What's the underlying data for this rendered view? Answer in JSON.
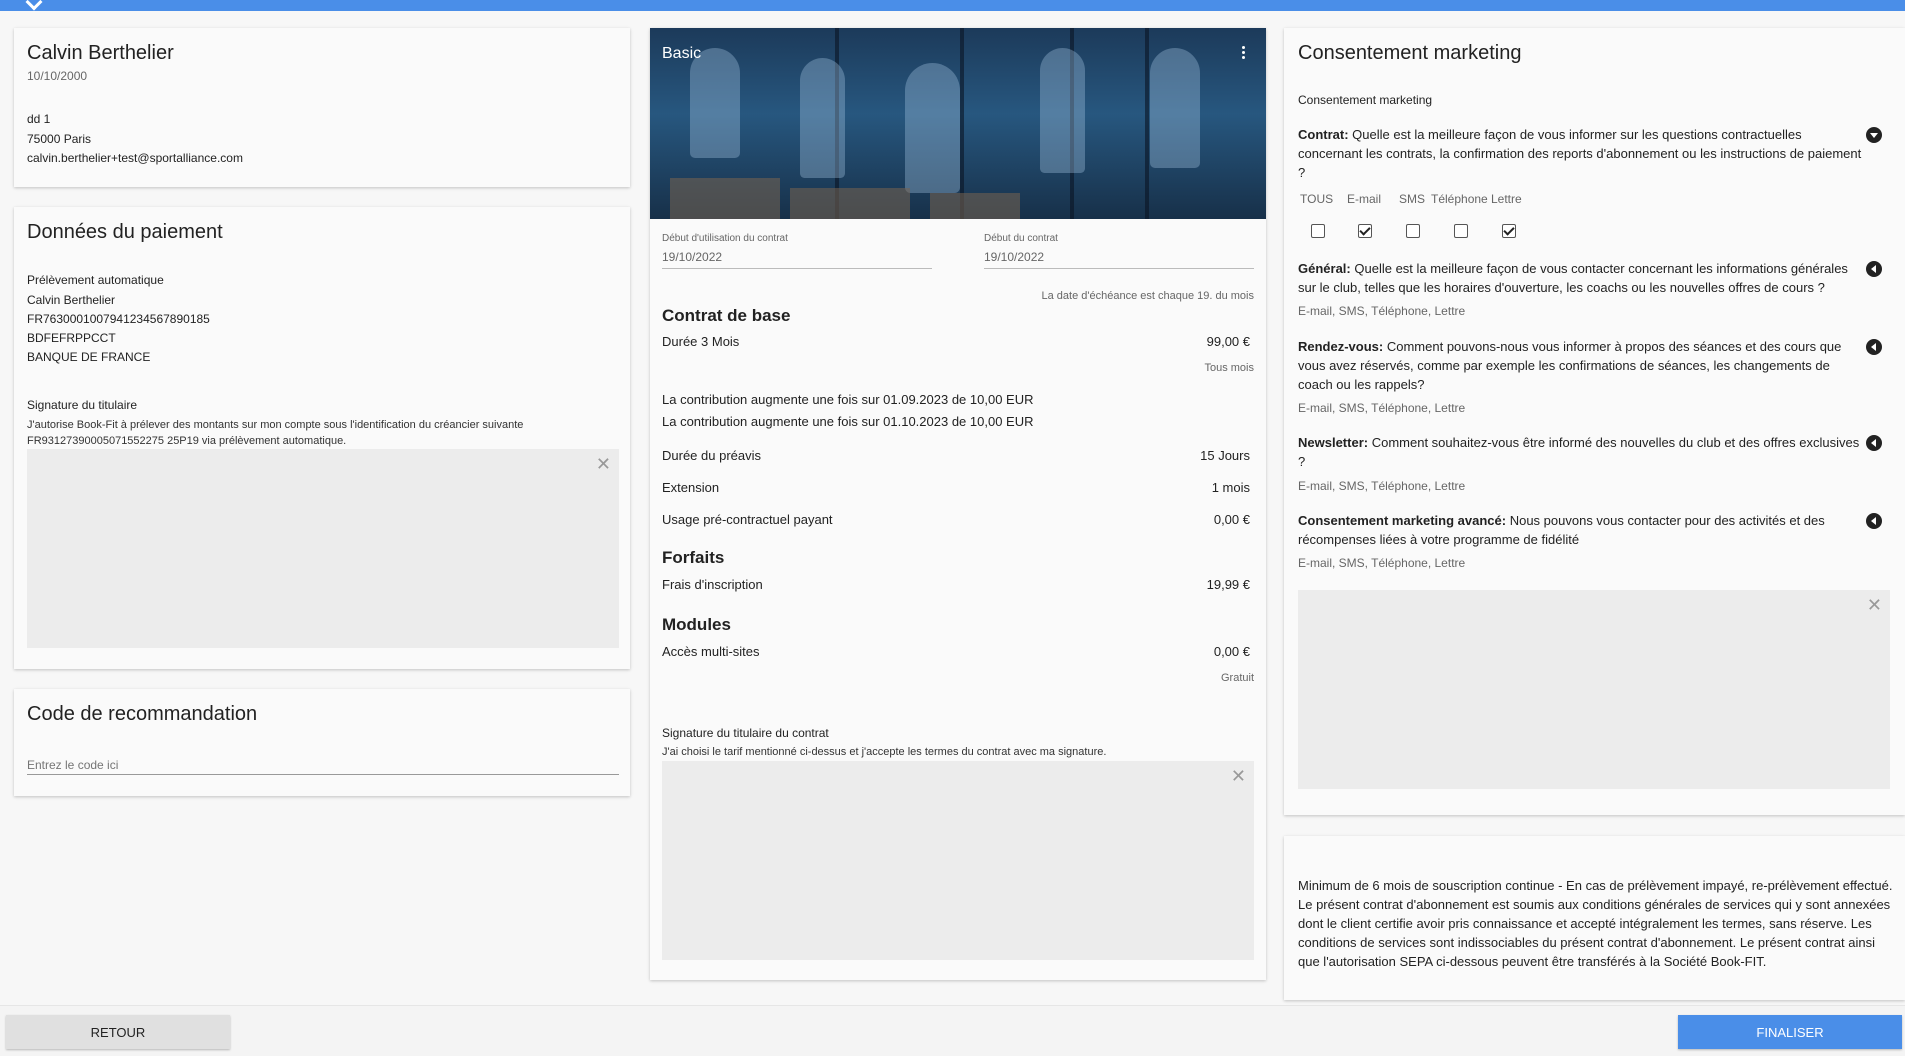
{
  "client": {
    "name": "Calvin Berthelier",
    "birthdate": "10/10/2000",
    "address_line1": "dd 1",
    "address_line2": "75000 Paris",
    "email": "calvin.berthelier+test@sportalliance.com"
  },
  "payment": {
    "title": "Données du paiement",
    "method": "Prélèvement automatique",
    "holder": "Calvin Berthelier",
    "iban": "FR7630001007941234567890185",
    "bic": "BDFEFRPPCCT",
    "bank": "BANQUE DE FRANCE",
    "signature_label": "Signature du titulaire",
    "signature_text": "J'autorise Book-Fit à prélever des montants sur mon compte sous l'identification du créancier suivante FR93127390005071552275 25P19 via prélèvement automatique."
  },
  "referral": {
    "title": "Code de recommandation",
    "placeholder": "Entrez le code ici"
  },
  "contract": {
    "plan_name": "Basic",
    "usage_start_label": "Début d'utilisation du contrat",
    "usage_start_value": "19/10/2022",
    "contract_start_label": "Début du contrat",
    "contract_start_value": "19/10/2022",
    "due_date_note": "La date d'échéance est chaque 19. du mois",
    "base_title": "Contrat de base",
    "duration_label": "Durée 3 Mois",
    "duration_price": "99,00 €",
    "duration_period": "Tous mois",
    "increase_1": "La contribution augmente une fois sur 01.09.2023 de 10,00 EUR",
    "increase_2": "La contribution augmente une fois sur 01.10.2023 de 10,00 EUR",
    "notice_label": "Durée du préavis",
    "notice_value": "15 Jours",
    "extension_label": "Extension",
    "extension_value": "1 mois",
    "precontract_label": "Usage pré-contractuel payant",
    "precontract_value": "0,00 €",
    "forfaits_title": "Forfaits",
    "inscription_label": "Frais d'inscription",
    "inscription_value": "19,99 €",
    "modules_title": "Modules",
    "multisite_label": "Accès multi-sites",
    "multisite_value": "0,00 €",
    "multisite_note": "Gratuit",
    "signature_label": "Signature du titulaire du contrat",
    "signature_text": "J'ai choisi le tarif mentionné ci-dessus et j'accepte les termes du contrat avec ma signature."
  },
  "marketing": {
    "title": "Consentement marketing",
    "subtitle": "Consentement marketing",
    "channels": [
      "TOUS",
      "E-mail",
      "SMS",
      "Téléphone",
      "Lettre"
    ],
    "checked": [
      false,
      true,
      false,
      false,
      true
    ],
    "items": [
      {
        "label": "Contrat:",
        "text": "Quelle est la meilleure façon de vous informer sur les questions contractuelles concernant les contrats, la confirmation des reports d'abonnement ou les instructions de paiement ?"
      },
      {
        "label": "Général:",
        "text": "Quelle est la meilleure façon de vous contacter concernant les informations générales sur le club, telles que les horaires d'ouverture, les coachs ou les nouvelles offres de cours ?",
        "channels": "E-mail, SMS, Téléphone, Lettre"
      },
      {
        "label": "Rendez-vous:",
        "text": "Comment pouvons-nous vous informer à propos des séances et des cours que vous avez réservés, comme par exemple les confirmations de séances, les changements de coach ou les rappels?",
        "channels": "E-mail, SMS, Téléphone, Lettre"
      },
      {
        "label": "Newsletter:",
        "text": "Comment souhaitez-vous être informé des nouvelles du club et des offres exclusives ?",
        "channels": "E-mail, SMS, Téléphone, Lettre"
      },
      {
        "label": "Consentement marketing avancé:",
        "text": "Nous pouvons vous contacter pour des activités et des récompenses liées à votre programme de fidélité",
        "channels": "E-mail, SMS, Téléphone, Lettre"
      }
    ]
  },
  "terms": {
    "text": "Minimum de 6 mois de souscription continue - En cas de prélèvement impayé, re-prélèvement effectué. Le présent contrat d'abonnement est soumis aux conditions générales de services qui y sont annexées dont le client certifie avoir pris connaissance et accepté intégralement les termes, sans réserve. Les conditions de services sont indissociables du présent contrat d'abonnement. Le présent contrat ainsi que l'autorisation SEPA ci-dessous peuvent être transférés à la Société Book-FIT."
  },
  "footer": {
    "back_label": "RETOUR",
    "finish_label": "FINALISER"
  },
  "colors": {
    "accent": "#4a8ee8",
    "finish_button": "#4a8ee8",
    "back_button": "#e0e0e0"
  },
  "icons": {
    "close": "close-icon",
    "menu": "more-vert-icon",
    "expand": "chevron-down-icon",
    "collapse": "chevron-left-icon"
  }
}
